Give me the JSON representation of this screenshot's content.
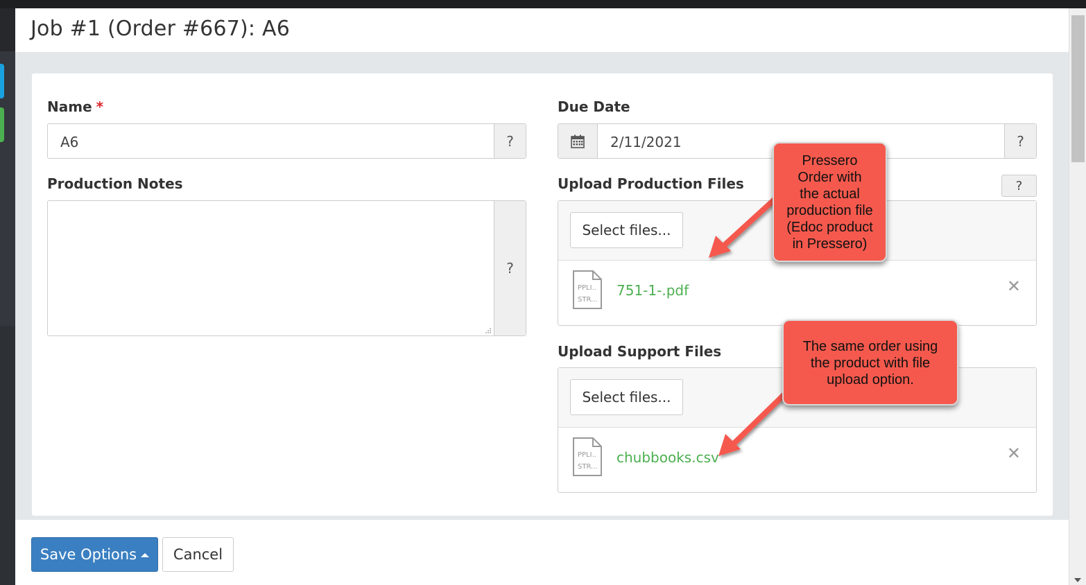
{
  "header": {
    "title": "Job #1 (Order #667): A6"
  },
  "form": {
    "name": {
      "label": "Name",
      "required_mark": "*",
      "value": "A6",
      "help": "?"
    },
    "production_notes": {
      "label": "Production Notes",
      "value": "",
      "help": "?"
    },
    "due_date": {
      "label": "Due Date",
      "value": "2/11/2021",
      "help": "?"
    },
    "production_files": {
      "label": "Upload Production Files",
      "help": "?",
      "select_label": "Select files...",
      "files": [
        {
          "name": "751-1-.pdf",
          "thumb_lines": [
            "PPLI..",
            "STR..."
          ]
        }
      ],
      "remove": "✕"
    },
    "support_files": {
      "label": "Upload Support Files",
      "select_label": "Select files...",
      "files": [
        {
          "name": "chubbooks.csv",
          "thumb_lines": [
            "PPLI..",
            "STR..."
          ]
        }
      ],
      "remove": "✕"
    }
  },
  "annotations": {
    "callout1": [
      "Pressero",
      "Order with",
      "the actual",
      "production file",
      "(Edoc product",
      "in Pressero)"
    ],
    "callout2": [
      "The same order using",
      "the product with file",
      "upload option."
    ],
    "color": "#f5594d"
  },
  "footer": {
    "save_label": "Save Options",
    "cancel_label": "Cancel"
  },
  "colors": {
    "primary": "#3a7fc1",
    "file_link": "#4caf50",
    "required": "#d9262c"
  }
}
